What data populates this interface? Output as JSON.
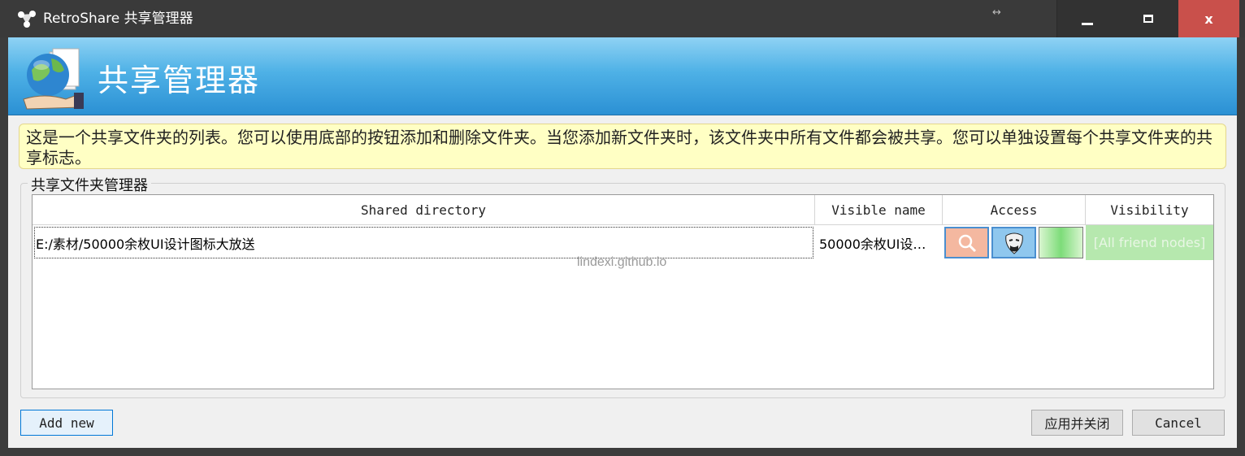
{
  "window": {
    "title": "RetroShare 共享管理器",
    "resize_glyph": "↔",
    "controls": {
      "minimize": "minimize",
      "maximize": "maximize",
      "close": "x"
    }
  },
  "header": {
    "title": "共享管理器",
    "icon": "globe-folder-icon"
  },
  "info": {
    "text": "这是一个共享文件夹的列表。您可以使用底部的按钮添加和删除文件夹。当您添加新文件夹时，该文件夹中所有文件都会被共享。您可以单独设置每个共享文件夹的共享标志。"
  },
  "group": {
    "title": "共享文件夹管理器"
  },
  "table": {
    "columns": [
      "Shared directory",
      "Visible name",
      "Access",
      "Visibility"
    ],
    "rows": [
      {
        "directory": "E:/素材/50000余枚UI设计图标大放送",
        "visible_name": "50000余枚UI设…",
        "access_icons": [
          "search-icon",
          "anonymous-mask-icon",
          "green-flag-icon"
        ],
        "visibility": "[All friend nodes]"
      }
    ]
  },
  "watermark": "lindexi.github.io",
  "buttons": {
    "add_new": "Add new",
    "apply_close": "应用并关闭",
    "cancel": "Cancel"
  },
  "colors": {
    "banner_top": "#8fd2f4",
    "banner_bottom": "#2b90d4",
    "info_bg": "#ffffc4",
    "close_button": "#c9504b",
    "visibility_bg": "#b6e8ae"
  }
}
